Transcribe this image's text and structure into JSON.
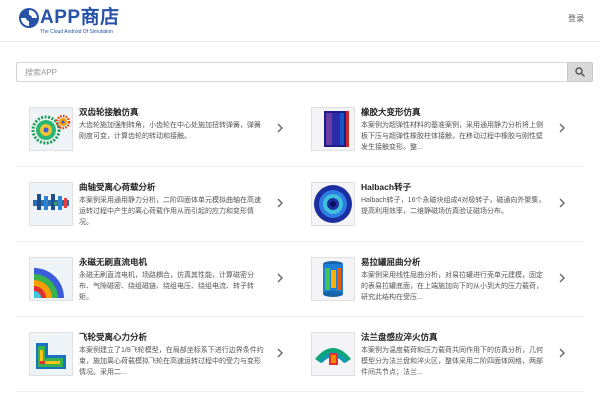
{
  "header": {
    "logo_title": "APP商店",
    "logo_subtitle": "The Cloud Android Of Simulation",
    "login_label": "登录"
  },
  "search": {
    "placeholder": "搜索APP"
  },
  "apps": [
    {
      "title": "双齿轮接触仿真",
      "description": "大齿轮施加强制转角，小齿轮在中心处施加扭转弹簧，弹簧刚度可变，计算齿轮的转动和接触。",
      "icon": "gear-pair-thumbnail"
    },
    {
      "title": "橡胶大变形仿真",
      "description": "本案例为超弹性材料的基准案例，采用通用静力分析将上侧板下压与超弹性橡胶柱体接触，在移动过程中橡胶与刚性壁发生接触变形。整...",
      "icon": "rubber-deformation-thumbnail"
    },
    {
      "title": "曲轴受离心荷载分析",
      "description": "本案例采用通用静力分析，二阶四面体单元模拟曲轴在高速运转过程中产生的离心荷载作用从而引起的应力和变形情况。",
      "icon": "crankshaft-thumbnail"
    },
    {
      "title": "Halbach转子",
      "description": "Halbach转子，16个永磁块组成4对极转子，磁通向外聚集，提高利用效率，二维静磁场仿真验证磁场分布。",
      "icon": "halbach-rotor-thumbnail"
    },
    {
      "title": "永磁无刷直流电机",
      "description": "永磁无刷直流电机，场路耦合，仿真其性能，计算磁密分布、气隙磁密、绕组磁链、绕组电压、绕组电流、转子转矩。",
      "icon": "bldc-motor-thumbnail"
    },
    {
      "title": "易拉罐屈曲分析",
      "description": "本案例采用线性屈曲分析，对易拉罐进行壳单元建模，固定的表易拉罐底面，在上端施加向下的从小到大的压力载荷，研究此结构在受压...",
      "icon": "can-buckling-thumbnail"
    },
    {
      "title": "飞轮受离心力分析",
      "description": "本案例建立了1/8飞轮模型，在局部坐标系下进行边界条件约束，施加离心荷载模拟飞轮在高速运转过程中的受力与变形情况。采用二...",
      "icon": "flywheel-thumbnail"
    },
    {
      "title": "法兰盘感应淬火仿真",
      "description": "本案例为温度载荷和压力载荷共同作用下的仿真分析，几何模型分为法兰盘和淬火区，整体采用二阶四面体网格，两部件间共节点；法兰...",
      "icon": "flange-quench-thumbnail"
    }
  ]
}
